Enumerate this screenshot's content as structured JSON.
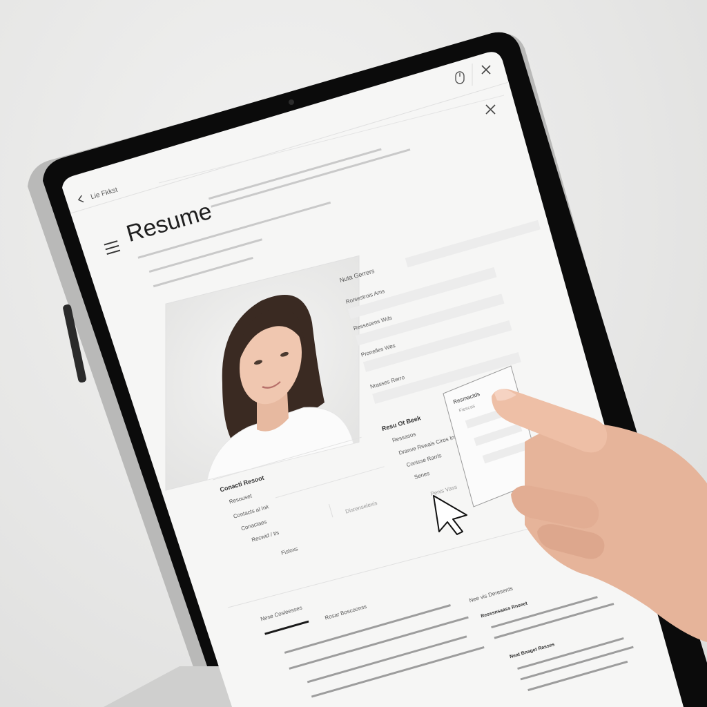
{
  "window": {
    "back_label": "Lie Fkkst",
    "title": "Resume",
    "close_icon_top": "close-icon",
    "close_icon_secondary": "close-icon",
    "top_button_icon": "mouse-icon",
    "menu_icon": "hamburger-icon"
  },
  "profile": {
    "photo_description_name": "profile-photo"
  },
  "left_column": {
    "section_title": "Conacti Resoot",
    "lines": [
      "Resouset",
      "Contacts al Ink",
      "Conactaes",
      "Recwid / tis",
      "Fisloxs"
    ],
    "aside_label": "Disrenselexis"
  },
  "form": {
    "section_label": "Nuta Gerrers",
    "fields": [
      {
        "label": "Rorsestrois Ams"
      },
      {
        "label": "Ressesens Wds"
      },
      {
        "label": "Pronelles Wes"
      },
      {
        "label": "Nrasses Rerro"
      }
    ]
  },
  "experience": {
    "title": "Resu Ot Beek",
    "lines": [
      "Ressasos",
      "Dranve Rswais Ciros Ins",
      "Conisse Rarrls",
      "Senes"
    ],
    "footer": "Penis Vass"
  },
  "popup": {
    "title": "Resmactds",
    "line": "Fiescas"
  },
  "bottom_left": {
    "heading": "Nese Cosleesses",
    "subheading": "Rosar Boscoonss"
  },
  "bottom_right": {
    "heading": "Nee vis Deresents",
    "sub_1": "Resssnsaass Rnseet",
    "sub_2": "Neat Bnaget Rasses"
  },
  "colors": {
    "bezel": "#0b0b0b",
    "frame": "#bdbdbd",
    "screen": "#f6f6f5",
    "accent_underline": "#1a1a1a"
  }
}
